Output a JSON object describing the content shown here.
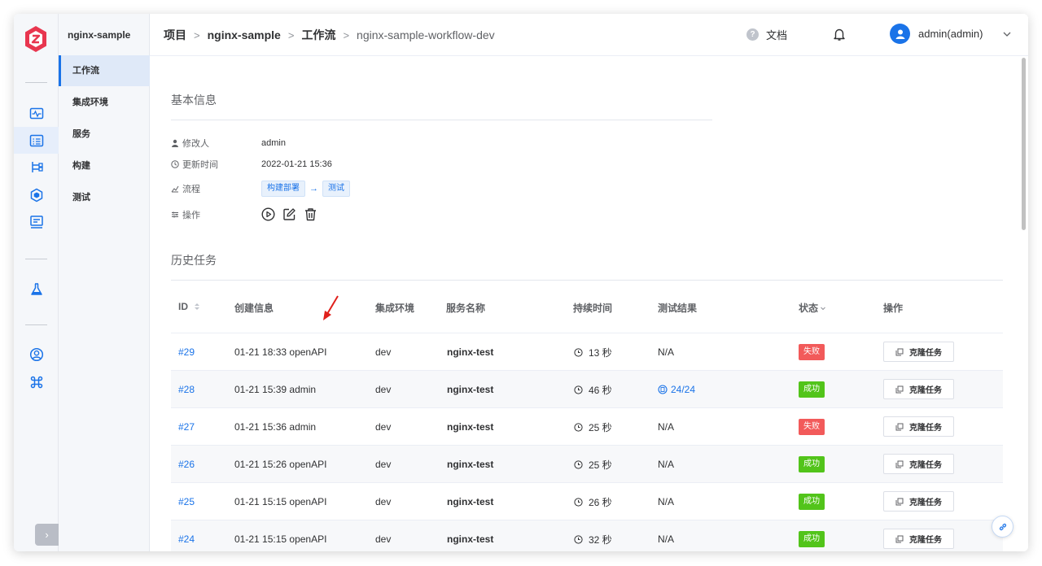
{
  "sidebar": {
    "project": "nginx-sample",
    "items": [
      {
        "label": "工作流"
      },
      {
        "label": "集成环境"
      },
      {
        "label": "服务"
      },
      {
        "label": "构建"
      },
      {
        "label": "测试"
      }
    ]
  },
  "header": {
    "breadcrumb": [
      "项目",
      "nginx-sample",
      "工作流",
      "nginx-sample-workflow-dev"
    ],
    "separator": ">",
    "docs_label": "文档",
    "user": "admin(admin)"
  },
  "basic_info": {
    "title": "基本信息",
    "modifier_label": "修改人",
    "modifier": "admin",
    "updated_label": "更新时间",
    "updated": "2022-01-21 15:36",
    "flow_label": "流程",
    "flow_steps": [
      "构建部署",
      "测试"
    ],
    "flow_arrow": "→",
    "ops_label": "操作"
  },
  "history": {
    "title": "历史任务",
    "columns": {
      "id": "ID",
      "created": "创建信息",
      "env": "集成环境",
      "service": "服务名称",
      "duration": "持续时间",
      "test": "测试结果",
      "status": "状态",
      "ops": "操作"
    },
    "clone_label": "克隆任务",
    "rows": [
      {
        "id": "#29",
        "created": "01-21 18:33 openAPI",
        "env": "dev",
        "service": "nginx-test",
        "duration": "13 秒",
        "test": "N/A",
        "status": "失败"
      },
      {
        "id": "#28",
        "created": "01-21 15:39 admin",
        "env": "dev",
        "service": "nginx-test",
        "duration": "46 秒",
        "test": "24/24",
        "status": "成功"
      },
      {
        "id": "#27",
        "created": "01-21 15:36 admin",
        "env": "dev",
        "service": "nginx-test",
        "duration": "25 秒",
        "test": "N/A",
        "status": "失败"
      },
      {
        "id": "#26",
        "created": "01-21 15:26 openAPI",
        "env": "dev",
        "service": "nginx-test",
        "duration": "25 秒",
        "test": "N/A",
        "status": "成功"
      },
      {
        "id": "#25",
        "created": "01-21 15:15 openAPI",
        "env": "dev",
        "service": "nginx-test",
        "duration": "26 秒",
        "test": "N/A",
        "status": "成功"
      },
      {
        "id": "#24",
        "created": "01-21 15:15 openAPI",
        "env": "dev",
        "service": "nginx-test",
        "duration": "32 秒",
        "test": "N/A",
        "status": "成功"
      }
    ]
  },
  "colors": {
    "accent": "#1a73e8",
    "success": "#52c41a",
    "fail": "#f25a5a",
    "annotation_arrow": "#e0201b"
  }
}
